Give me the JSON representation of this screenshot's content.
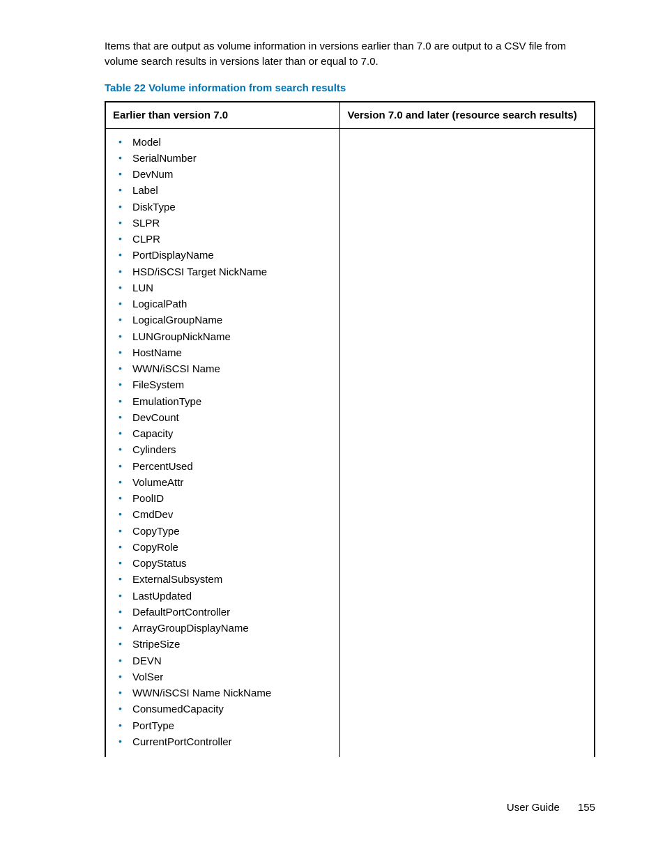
{
  "intro": "Items that are output as volume information in versions earlier than 7.0 are output to a CSV file from volume search results in versions later than or equal to 7.0.",
  "table": {
    "caption": "Table 22 Volume information from search results",
    "header": {
      "col1": "Earlier than version 7.0",
      "col2": "Version 7.0 and later (resource search results)"
    },
    "col1_items": [
      "Model",
      "SerialNumber",
      "DevNum",
      "Label",
      "DiskType",
      "SLPR",
      "CLPR",
      "PortDisplayName",
      "HSD/iSCSI Target NickName",
      "LUN",
      "LogicalPath",
      "LogicalGroupName",
      "LUNGroupNickName",
      "HostName",
      "WWN/iSCSI Name",
      "FileSystem",
      "EmulationType",
      "DevCount",
      "Capacity",
      "Cylinders",
      "PercentUsed",
      "VolumeAttr",
      "PoolID",
      "CmdDev",
      "CopyType",
      "CopyRole",
      "CopyStatus",
      "ExternalSubsystem",
      "LastUpdated",
      "DefaultPortController",
      "ArrayGroupDisplayName",
      "StripeSize",
      "DEVN",
      "VolSer",
      "WWN/iSCSI Name NickName",
      "ConsumedCapacity",
      "PortType",
      "CurrentPortController"
    ],
    "col2_content": ""
  },
  "footer": {
    "label": "User Guide",
    "page": "155"
  }
}
